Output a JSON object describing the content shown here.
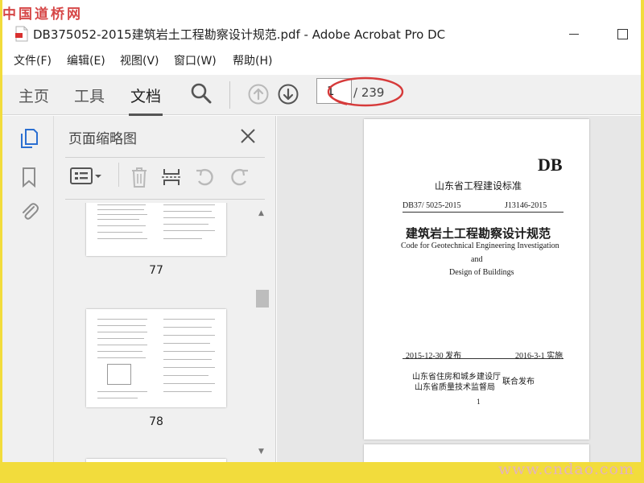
{
  "watermark": {
    "top": "中国道桥网",
    "bottom": "www.cndao.com"
  },
  "window": {
    "title": "DB375052-2015建筑岩土工程勘察设计规范.pdf - Adobe Acrobat Pro DC"
  },
  "menu": [
    "文件(F)",
    "编辑(E)",
    "视图(V)",
    "窗口(W)",
    "帮助(H)"
  ],
  "toolbar": {
    "tabs": [
      "主页",
      "工具",
      "文档"
    ],
    "active_tab": "文档",
    "page_current": "1",
    "page_total": "/ 239",
    "highlight_color": "#d63a3a"
  },
  "panel": {
    "title": "页面缩略图",
    "thumbs": [
      {
        "label": "77"
      },
      {
        "label": "78"
      }
    ]
  },
  "document": {
    "db": "DB",
    "category": "山东省工程建设标准",
    "code": "DB37/ 5025-2015",
    "record": "J13146-2015",
    "title_cn": "建筑岩土工程勘察设计规范",
    "title_en_1": "Code for Geotechnical Engineering Investigation",
    "title_en_2": "and",
    "title_en_3": "Design of Buildings",
    "issued": "2015-12-30  发布",
    "implemented": "2016-3-1  实施",
    "publisher_1": "山东省住房和城乡建设厅",
    "publisher_2": "山东省质量技术监督局",
    "joint": "联合发布",
    "page_number": "1"
  },
  "colors": {
    "accent": "#2b6fd1",
    "frame": "#f2dc3c",
    "watermark_red": "#d64747"
  }
}
